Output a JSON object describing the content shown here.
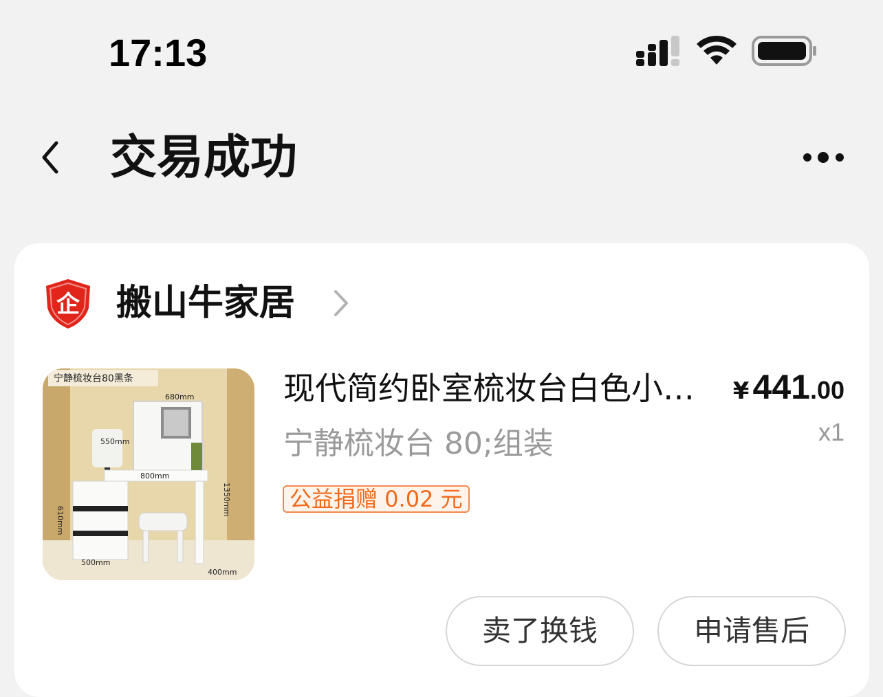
{
  "status_bar": {
    "time": "17:13",
    "signal_icon": "cellular-signal-icon",
    "wifi_icon": "wifi-icon",
    "battery_icon": "battery-icon"
  },
  "nav": {
    "back_icon": "chevron-left-icon",
    "title": "交易成功",
    "more_icon": "more-dots-icon"
  },
  "shop": {
    "logo_icon": "enterprise-shield-icon",
    "logo_char": "企",
    "name": "搬山牛家居",
    "chevron_icon": "chevron-right-icon"
  },
  "product": {
    "image_caption": "宁静梳妆台80黑条",
    "image_dims": [
      "680mm",
      "550mm",
      "800mm",
      "1350mm",
      "610mm",
      "500mm",
      "400mm"
    ],
    "title": "现代简约卧室梳妆台白色小户型收纳",
    "price_symbol": "¥",
    "price_int": "441",
    "price_dec": ".00",
    "quantity": "x1",
    "sku": "宁静梳妆台 80;组装",
    "donation": "公益捐赠 0.02 元"
  },
  "actions": {
    "sell_label": "卖了换钱",
    "aftersale_label": "申请售后"
  },
  "colors": {
    "background": "#f2f2f2",
    "card": "#ffffff",
    "donation_orange": "#f06a1a",
    "shop_logo_red": "#e1251b"
  }
}
